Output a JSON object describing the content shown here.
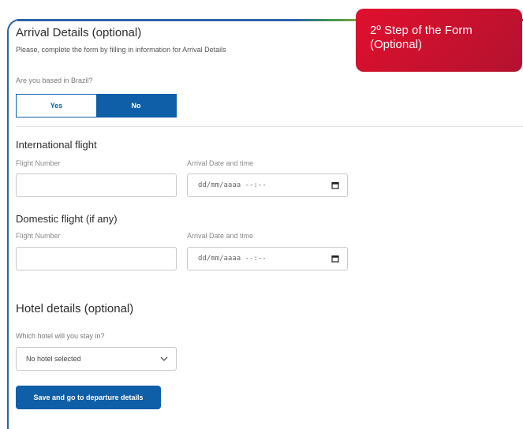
{
  "arrival": {
    "title": "Arrival Details (optional)",
    "subtitle": "Please, complete the form by filling in information for Arrival Details"
  },
  "brazil": {
    "question": "Are you based in Brazil?",
    "yes_label": "Yes",
    "no_label": "No",
    "selected": "No"
  },
  "international": {
    "title": "International flight",
    "flight_label": "Flight Number",
    "flight_value": "",
    "date_label": "Arrival Date and time",
    "date_placeholder": "dd/mm/aaaa --:--"
  },
  "domestic": {
    "title": "Domestic flight (if any)",
    "flight_label": "Flight Number",
    "flight_value": "",
    "date_label": "Arrival Date and time",
    "date_placeholder": "dd/mm/aaaa --:--"
  },
  "hotel": {
    "title": "Hotel details (optional)",
    "question": "Which hotel will you stay in?",
    "selected": "No hotel selected"
  },
  "submit_label": "Save and go to departure details",
  "callout": {
    "line1": "2º Step of the Form",
    "line2": "(Optional)"
  },
  "colors": {
    "primary": "#0f5ea8",
    "callout": "#e0102e"
  },
  "icons": {
    "calendar": "calendar-icon",
    "dropdown": "chevron-down-icon"
  }
}
